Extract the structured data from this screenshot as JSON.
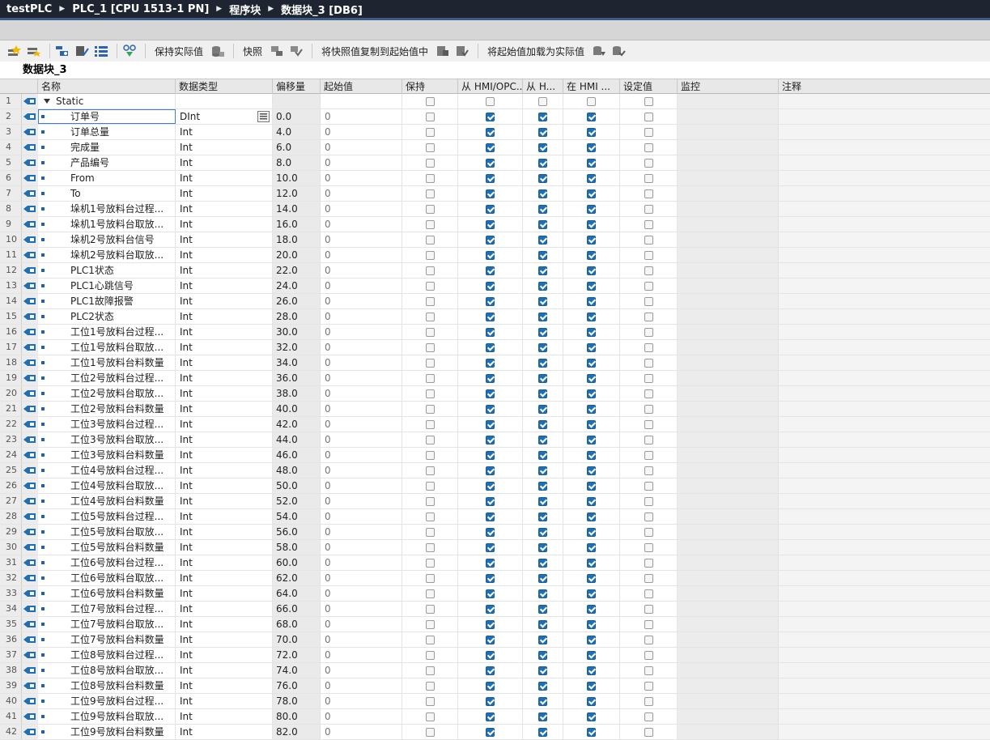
{
  "breadcrumb": [
    "testPLC",
    "PLC_1 [CPU 1513-1 PN]",
    "程序块",
    "数据块_3 [DB6]"
  ],
  "toolbar": {
    "keep_actual_label": "保持实际值",
    "snapshot_label": "快照",
    "copy_snapshot_label": "将快照值复制到起始值中",
    "load_start_label": "将起始值加载为实际值"
  },
  "editor": {
    "title": "数据块_3"
  },
  "columns": {
    "name": "名称",
    "type": "数据类型",
    "offset": "偏移量",
    "start": "起始值",
    "retain": "保持",
    "hmi_access": "从 HMI/OPC...",
    "hmi_write": "从 H...",
    "hmi_visible": "在 HMI ...",
    "setpoint": "设定值",
    "monitor": "监控",
    "comment": "注释"
  },
  "static_row": {
    "num": "1",
    "name": "Static"
  },
  "rows": [
    {
      "num": "2",
      "name": "订单号",
      "type": "DInt",
      "offset": "0.0",
      "start": "0"
    },
    {
      "num": "3",
      "name": "订单总量",
      "type": "Int",
      "offset": "4.0",
      "start": "0"
    },
    {
      "num": "4",
      "name": "完成量",
      "type": "Int",
      "offset": "6.0",
      "start": "0"
    },
    {
      "num": "5",
      "name": "产品编号",
      "type": "Int",
      "offset": "8.0",
      "start": "0"
    },
    {
      "num": "6",
      "name": "From",
      "type": "Int",
      "offset": "10.0",
      "start": "0"
    },
    {
      "num": "7",
      "name": "To",
      "type": "Int",
      "offset": "12.0",
      "start": "0"
    },
    {
      "num": "8",
      "name": "垛机1号放料台过程...",
      "type": "Int",
      "offset": "14.0",
      "start": "0"
    },
    {
      "num": "9",
      "name": "垛机1号放料台取放...",
      "type": "Int",
      "offset": "16.0",
      "start": "0"
    },
    {
      "num": "10",
      "name": "垛机2号放料台信号",
      "type": "Int",
      "offset": "18.0",
      "start": "0"
    },
    {
      "num": "11",
      "name": "垛机2号放料台取放...",
      "type": "Int",
      "offset": "20.0",
      "start": "0"
    },
    {
      "num": "12",
      "name": "PLC1状态",
      "type": "Int",
      "offset": "22.0",
      "start": "0"
    },
    {
      "num": "13",
      "name": "PLC1心跳信号",
      "type": "Int",
      "offset": "24.0",
      "start": "0"
    },
    {
      "num": "14",
      "name": "PLC1故障报警",
      "type": "Int",
      "offset": "26.0",
      "start": "0"
    },
    {
      "num": "15",
      "name": "PLC2状态",
      "type": "Int",
      "offset": "28.0",
      "start": "0"
    },
    {
      "num": "16",
      "name": "工位1号放料台过程...",
      "type": "Int",
      "offset": "30.0",
      "start": "0"
    },
    {
      "num": "17",
      "name": "工位1号放料台取放...",
      "type": "Int",
      "offset": "32.0",
      "start": "0"
    },
    {
      "num": "18",
      "name": "工位1号放料台料数量",
      "type": "Int",
      "offset": "34.0",
      "start": "0"
    },
    {
      "num": "19",
      "name": "工位2号放料台过程...",
      "type": "Int",
      "offset": "36.0",
      "start": "0"
    },
    {
      "num": "20",
      "name": "工位2号放料台取放...",
      "type": "Int",
      "offset": "38.0",
      "start": "0"
    },
    {
      "num": "21",
      "name": "工位2号放料台料数量",
      "type": "Int",
      "offset": "40.0",
      "start": "0"
    },
    {
      "num": "22",
      "name": "工位3号放料台过程...",
      "type": "Int",
      "offset": "42.0",
      "start": "0"
    },
    {
      "num": "23",
      "name": "工位3号放料台取放...",
      "type": "Int",
      "offset": "44.0",
      "start": "0"
    },
    {
      "num": "24",
      "name": "工位3号放料台料数量",
      "type": "Int",
      "offset": "46.0",
      "start": "0"
    },
    {
      "num": "25",
      "name": "工位4号放料台过程...",
      "type": "Int",
      "offset": "48.0",
      "start": "0"
    },
    {
      "num": "26",
      "name": "工位4号放料台取放...",
      "type": "Int",
      "offset": "50.0",
      "start": "0"
    },
    {
      "num": "27",
      "name": "工位4号放料台料数量",
      "type": "Int",
      "offset": "52.0",
      "start": "0"
    },
    {
      "num": "28",
      "name": "工位5号放料台过程...",
      "type": "Int",
      "offset": "54.0",
      "start": "0"
    },
    {
      "num": "29",
      "name": "工位5号放料台取放...",
      "type": "Int",
      "offset": "56.0",
      "start": "0"
    },
    {
      "num": "30",
      "name": "工位5号放料台料数量",
      "type": "Int",
      "offset": "58.0",
      "start": "0"
    },
    {
      "num": "31",
      "name": "工位6号放料台过程...",
      "type": "Int",
      "offset": "60.0",
      "start": "0"
    },
    {
      "num": "32",
      "name": "工位6号放料台取放...",
      "type": "Int",
      "offset": "62.0",
      "start": "0"
    },
    {
      "num": "33",
      "name": "工位6号放料台料数量",
      "type": "Int",
      "offset": "64.0",
      "start": "0"
    },
    {
      "num": "34",
      "name": "工位7号放料台过程...",
      "type": "Int",
      "offset": "66.0",
      "start": "0"
    },
    {
      "num": "35",
      "name": "工位7号放料台取放...",
      "type": "Int",
      "offset": "68.0",
      "start": "0"
    },
    {
      "num": "36",
      "name": "工位7号放料台料数量",
      "type": "Int",
      "offset": "70.0",
      "start": "0"
    },
    {
      "num": "37",
      "name": "工位8号放料台过程...",
      "type": "Int",
      "offset": "72.0",
      "start": "0"
    },
    {
      "num": "38",
      "name": "工位8号放料台取放...",
      "type": "Int",
      "offset": "74.0",
      "start": "0"
    },
    {
      "num": "39",
      "name": "工位8号放料台料数量",
      "type": "Int",
      "offset": "76.0",
      "start": "0"
    },
    {
      "num": "40",
      "name": "工位9号放料台过程...",
      "type": "Int",
      "offset": "78.0",
      "start": "0"
    },
    {
      "num": "41",
      "name": "工位9号放料台取放...",
      "type": "Int",
      "offset": "80.0",
      "start": "0"
    },
    {
      "num": "42",
      "name": "工位9号放料台料数量",
      "type": "Int",
      "offset": "82.0",
      "start": "0"
    }
  ],
  "colors": {
    "title_bg": "#1e2430",
    "accent": "#1e6fb4",
    "header_bg": "#e8e8e8"
  },
  "icons": {
    "row": "db-row-icon",
    "toolbar": [
      "insert-row-icon",
      "add-row-icon",
      "expand-icon",
      "collapse-icon",
      "list-icon",
      "monitor-icon",
      "db-icon",
      "snapshot-icon",
      "copy-icon",
      "load-icon"
    ]
  }
}
